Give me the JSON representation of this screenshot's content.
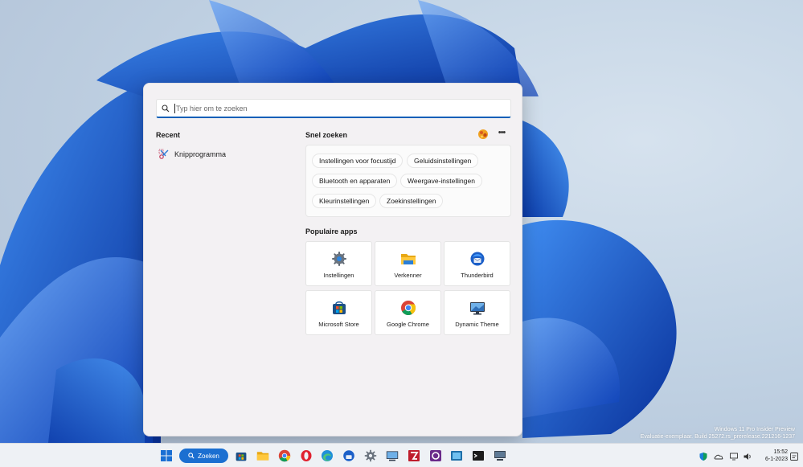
{
  "search": {
    "placeholder": "Typ hier om te zoeken"
  },
  "recent": {
    "title": "Recent",
    "items": [
      {
        "label": "Knipprogramma",
        "icon": "snipping-tool-icon"
      }
    ]
  },
  "quick_search": {
    "title": "Snel zoeken",
    "chips": [
      "Instellingen voor focustijd",
      "Geluidsinstellingen",
      "Bluetooth en apparaten",
      "Weergave-instellingen",
      "Kleurinstellingen",
      "Zoekinstellingen"
    ]
  },
  "popular_apps": {
    "title": "Populaire apps",
    "apps": [
      {
        "label": "Instellingen",
        "icon": "settings-gear-icon"
      },
      {
        "label": "Verkenner",
        "icon": "file-explorer-icon"
      },
      {
        "label": "Thunderbird",
        "icon": "thunderbird-icon"
      },
      {
        "label": "Microsoft Store",
        "icon": "microsoft-store-icon"
      },
      {
        "label": "Google Chrome",
        "icon": "chrome-icon"
      },
      {
        "label": "Dynamic Theme",
        "icon": "dynamic-theme-icon"
      }
    ]
  },
  "watermark": {
    "line1": "Windows 11 Pro Insider Preview",
    "line2": "Evaluatie-exemplaar. Build 25272.rs_prerelease.221216-1237"
  },
  "taskbar": {
    "search_label": "Zoeken",
    "time": "15:52",
    "date": "6-1-2023"
  },
  "colors": {
    "accent": "#1b6fd1",
    "panel": "#f3f1f3"
  }
}
